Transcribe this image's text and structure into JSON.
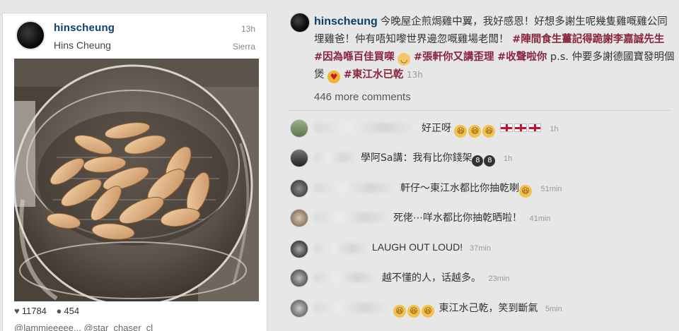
{
  "post": {
    "username": "hinscheung",
    "full_name": "Hins Cheung",
    "time": "13h",
    "location": "Sierra",
    "likes": "11784",
    "comments_count": "454",
    "mentions": "@lammieeeee... @star_chaser_cl",
    "photo_icon": "photo-of-chicken-wings-in-convection-oven"
  },
  "caption": {
    "username": "hinscheung",
    "text_part1": "今晚屋企煎焗雞中翼，我好感恩！好想多謝生呢幾隻雞嘅雞公同埋雞爸！仲有唔知嚟世界邊忽嘅雞場老闆！",
    "tag1": "#陣間食生薑記得跪謝李嘉誠先生",
    "tag2": "#因為喺百佳買㗎",
    "tag3": "#張軒你又講歪理",
    "tag4": "#收聲啦你",
    "text_part2": "p.s. 仲要多謝德國寶發明個煲",
    "tag5": "#東江水已乾",
    "time": "13h",
    "emoji1_icon": "relieved-face-icon",
    "emoji2_icon": "heart-eyes-face-icon"
  },
  "more_comments": "446 more comments",
  "comments": [
    {
      "text": "好正呀",
      "lol_count": 3,
      "flag_count": 3,
      "time": "1h"
    },
    {
      "text": "學阿Sa講：我有比你錢架",
      "time": "1h"
    },
    {
      "text": "軒仔～東江水都比你抽乾喇",
      "time": "51min"
    },
    {
      "text": "死佬⋯咩水都比你抽乾晒啦！",
      "time": "41min"
    },
    {
      "text": "LAUGH OUT LOUD!",
      "time": "37min"
    },
    {
      "text": "越不懂的人，话越多。",
      "time": "23min"
    },
    {
      "text": "東江水己乾，笑到斷氣",
      "time": "5min"
    }
  ],
  "icons": {
    "heart": "♥",
    "bubble": "●",
    "lol": "😂",
    "cool": "😎"
  }
}
